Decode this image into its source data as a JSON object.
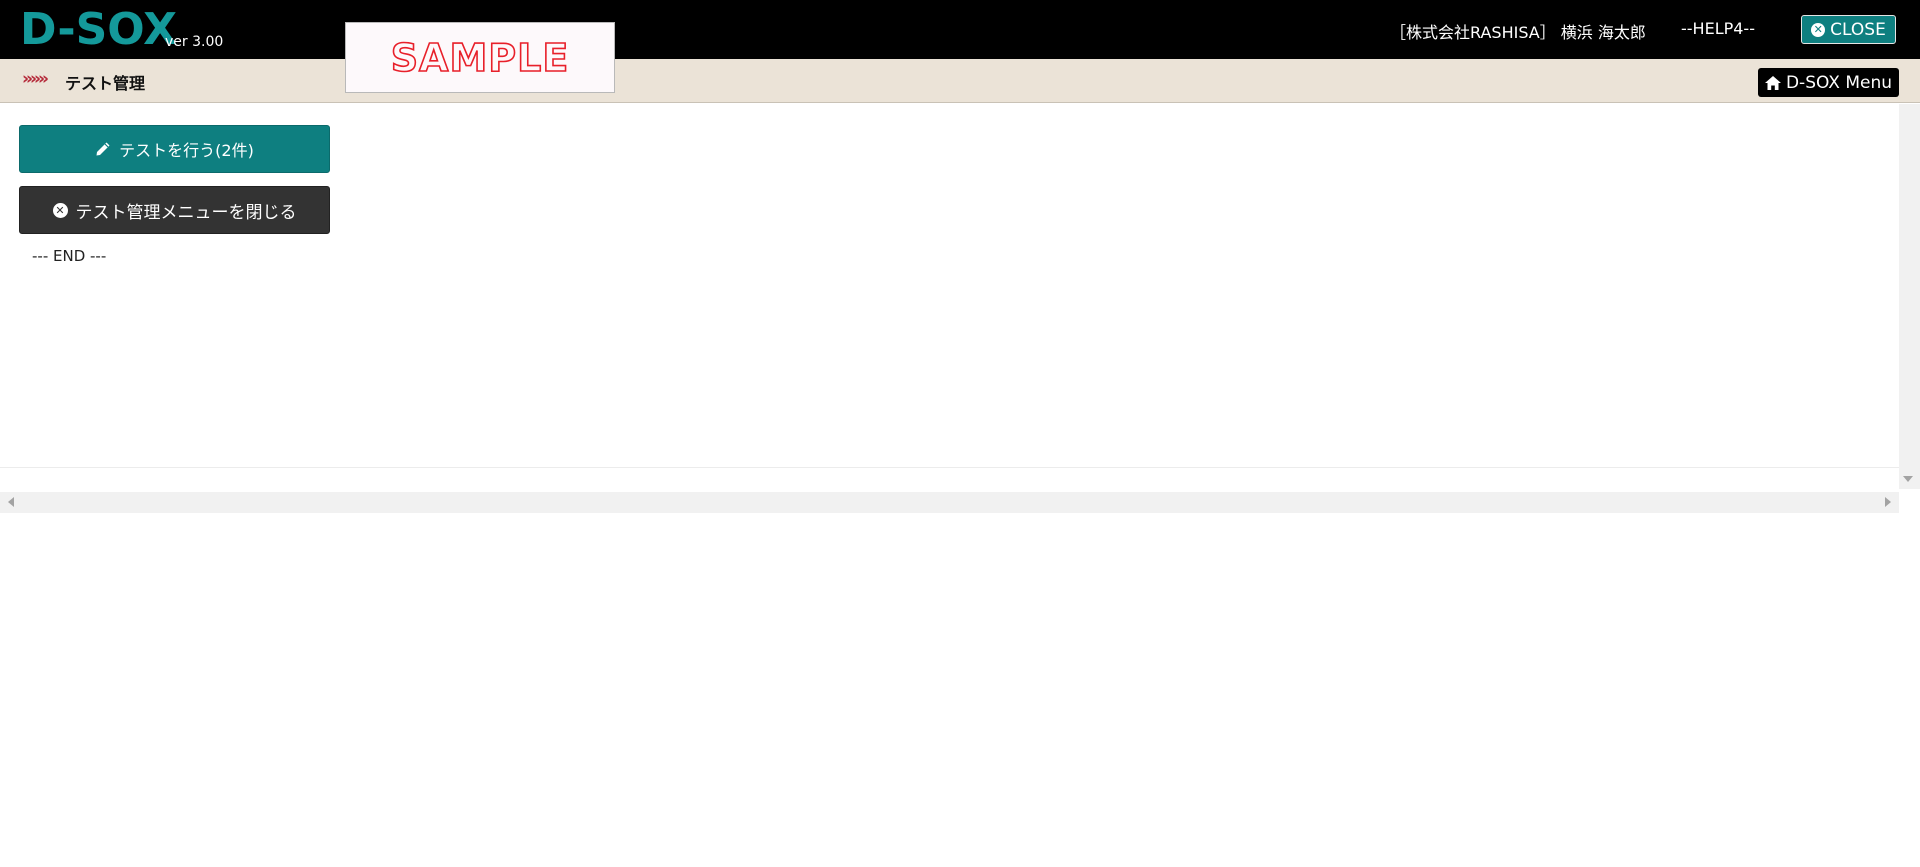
{
  "header": {
    "logo": "D-SOX",
    "version": "ver 3.00",
    "sample_stamp": "SAMPLE",
    "user_info": "［株式会社RASHISA］ 横浜 海太郎",
    "help": "--HELP4--",
    "close_label": "CLOSE",
    "colors": {
      "background": "#000000",
      "logo": "#14999a",
      "close_button": "#0e7f80"
    }
  },
  "breadcrumb": {
    "chevrons": "»»»",
    "title": "テスト管理",
    "menu_button_label": "D-SOX Menu",
    "colors": {
      "background": "#ebe3d7",
      "chevrons": "#b52a3a"
    }
  },
  "main": {
    "test_button_label": "テストを行う(2件)",
    "close_menu_button_label": "テスト管理メニューを閉じる",
    "end_text": "--- END ---",
    "colors": {
      "test_button": "#0e7f80",
      "close_menu_button": "#333333"
    },
    "icons": {
      "test_button": "pencil-icon",
      "close_menu_button": "close-circle-icon"
    }
  }
}
